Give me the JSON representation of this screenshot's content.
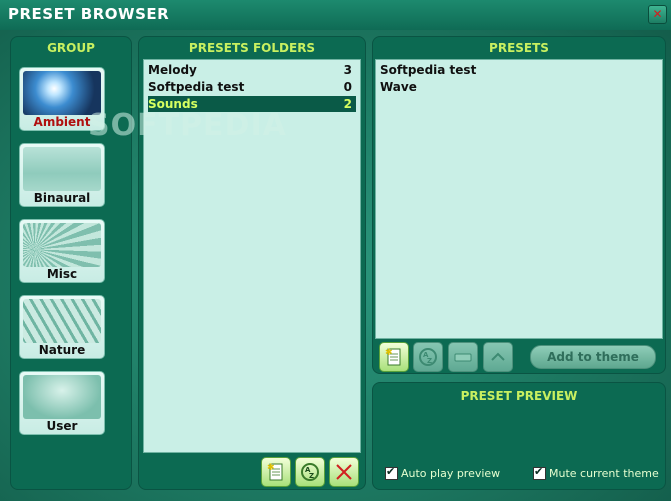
{
  "window": {
    "title": "PRESET BROWSER"
  },
  "group": {
    "heading": "GROUP",
    "items": [
      {
        "label": "Ambient",
        "selected": true
      },
      {
        "label": "Binaural"
      },
      {
        "label": "Misc"
      },
      {
        "label": "Nature"
      },
      {
        "label": "User"
      }
    ]
  },
  "folders": {
    "heading": "PRESETS FOLDERS",
    "rows": [
      {
        "name": "Melody",
        "count": "3"
      },
      {
        "name": "Softpedia test",
        "count": "0"
      },
      {
        "name": "Sounds",
        "count": "2",
        "selected": true
      }
    ]
  },
  "presets": {
    "heading": "PRESETS",
    "rows": [
      {
        "name": "Softpedia test"
      },
      {
        "name": "Wave"
      }
    ],
    "add_label": "Add to theme"
  },
  "preview": {
    "heading": "PRESET PREVIEW",
    "auto_play": "Auto play preview",
    "mute": "Mute current theme"
  },
  "watermark": "SOFTPEDIA",
  "colors": {
    "accent": "#c8f060",
    "selected_row": "#0a5a47",
    "panel": "#0c6a52"
  }
}
